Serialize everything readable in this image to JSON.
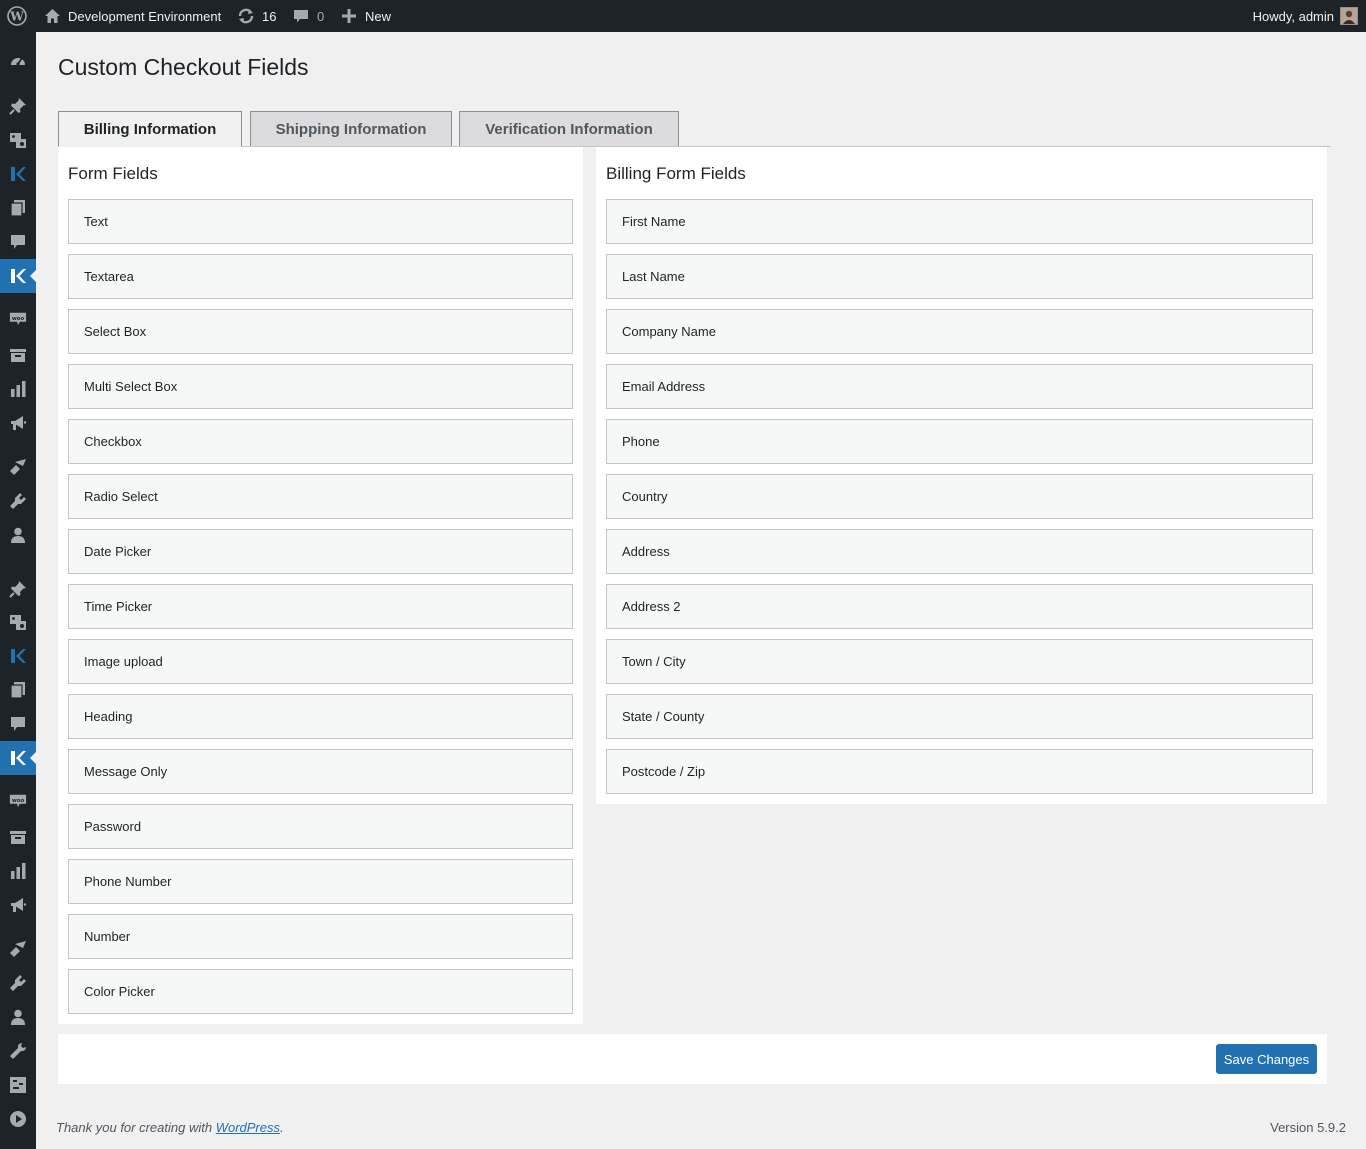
{
  "admin_bar": {
    "site_name": "Development Environment",
    "updates_count": "16",
    "comments_count": "0",
    "new_label": "New",
    "greeting": "Howdy, admin"
  },
  "side_menu": {
    "icons": [
      "dashboard-icon",
      "pin-icon",
      "media-icon",
      "plugin-k-icon",
      "pages-icon",
      "comments-icon",
      "plugin-k-icon",
      "woo-icon",
      "products-icon",
      "analytics-icon",
      "marketing-icon",
      "appearance-icon",
      "plugins-icon",
      "users-icon",
      "pin-icon",
      "media-icon",
      "plugin-k-icon",
      "pages-icon",
      "comments-icon",
      "plugin-k-icon",
      "woo-icon",
      "products-icon",
      "analytics-icon",
      "marketing-icon",
      "appearance-icon",
      "plugins-icon",
      "users-icon",
      "tools-icon",
      "settings-icon",
      "play-icon"
    ]
  },
  "page": {
    "title": "Custom Checkout Fields"
  },
  "tabs": [
    {
      "label": "Billing Information",
      "active": true
    },
    {
      "label": "Shipping Information",
      "active": false
    },
    {
      "label": "Verification Information",
      "active": false
    }
  ],
  "form_fields": {
    "title": "Form Fields",
    "items": [
      "Text",
      "Textarea",
      "Select Box",
      "Multi Select Box",
      "Checkbox",
      "Radio Select",
      "Date Picker",
      "Time Picker",
      "Image upload",
      "Heading",
      "Message Only",
      "Password",
      "Phone Number",
      "Number",
      "Color Picker"
    ]
  },
  "billing_fields": {
    "title": "Billing Form Fields",
    "items": [
      "First Name",
      "Last Name",
      "Company Name",
      "Email Address",
      "Phone",
      "Country",
      "Address",
      "Address 2",
      "Town / City",
      "State / County",
      "Postcode / Zip"
    ]
  },
  "actions": {
    "save_label": "Save Changes"
  },
  "footer": {
    "thanks_prefix": "Thank you for creating with ",
    "wordpress_link": "WordPress",
    "thanks_suffix": ".",
    "version": "Version 5.9.2"
  },
  "colors": {
    "admin_bar_bg": "#1d2327",
    "accent": "#2271b1",
    "page_bg": "#f0f0f1"
  }
}
